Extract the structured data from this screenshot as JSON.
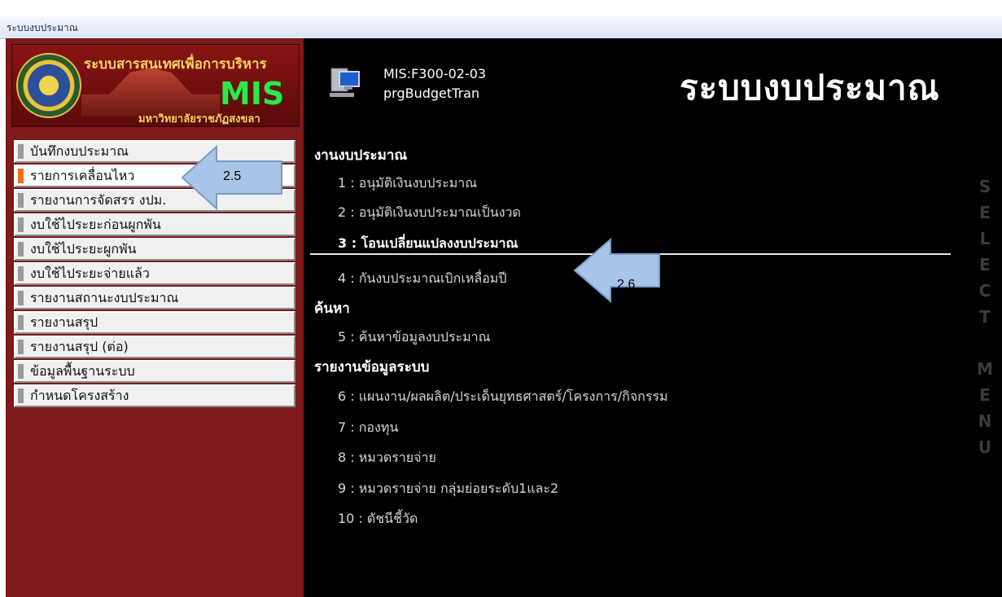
{
  "window": {
    "title": "ระบบงบประมาณ"
  },
  "banner": {
    "title": "ระบบสารสนเทศเพื่อการบริหาร",
    "mis": "MIS",
    "subtitle": "มหาวิทยาลัยราชภัฏสงขลา"
  },
  "sidebar": {
    "items": [
      {
        "label": "บันทึกงบประมาณ",
        "active": false
      },
      {
        "label": "รายการเคลื่อนไหว",
        "active": true
      },
      {
        "label": "รายงานการจัดสรร งปม.",
        "active": false
      },
      {
        "label": "งบใช้ไประยะก่อนผูกพัน",
        "active": false
      },
      {
        "label": "งบใช้ไประยะผูกพัน",
        "active": false
      },
      {
        "label": "งบใช้ไประยะจ่ายแล้ว",
        "active": false
      },
      {
        "label": "รายงานสถานะงบประมาณ",
        "active": false
      },
      {
        "label": "รายงานสรุป",
        "active": false
      },
      {
        "label": "รายงานสรุป (ต่อ)",
        "active": false
      },
      {
        "label": "ข้อมูลพื้นฐานระบบ",
        "active": false
      },
      {
        "label": "กำหนดโครงสร้าง",
        "active": false
      }
    ]
  },
  "header": {
    "code": "MIS:F300-02-03",
    "program": "prgBudgetTran",
    "title": "ระบบงบประมาณ",
    "icon": "computer-icon"
  },
  "sections": [
    {
      "title": "งานงบประมาณ",
      "options": [
        "1 : อนุมัติเงินงบประมาณ",
        "2 : อนุมัติเงินงบประมาณเป็นงวด",
        "3 : โอนเปลี่ยนแปลงงบประมาณ",
        "4 : กันงบประมาณเบิกเหลื่อมปี"
      ]
    },
    {
      "title": "ค้นหา",
      "options": [
        "5 : ค้นหาข้อมูลงบประมาณ"
      ]
    },
    {
      "title": "รายงานข้อมูลระบบ",
      "options": [
        "6 : แผนงาน/ผลผลิต/ประเด็นยุทธศาสตร์/โครงการ/กิจกรรม",
        "7 : กองทุน",
        "8 : หมวดรายจ่าย",
        "9 : หมวดรายจ่าย กลุ่มย่อยระดับ1และ2",
        "10 : ดัชนีชี้วัด"
      ]
    }
  ],
  "current_option": "3 : โอนเปลี่ยนแปลงงบประมาณ",
  "vertical_label": [
    "S",
    "E",
    "L",
    "E",
    "C",
    "T",
    "",
    "M",
    "E",
    "N",
    "U"
  ],
  "callouts": [
    {
      "label": "2.5"
    },
    {
      "label": "2.6"
    }
  ],
  "colors": {
    "left_bg": "#7d1a1b",
    "right_bg": "#000000",
    "active_marker": "#f26a1b",
    "callout_fill": "#a8c4e6"
  }
}
